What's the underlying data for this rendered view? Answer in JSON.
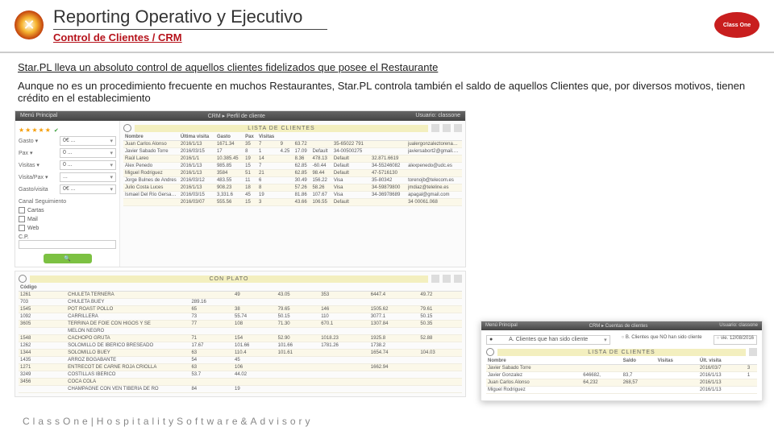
{
  "header": {
    "title": "Reporting Operativo y Ejecutivo",
    "subtitle": "Control de Clientes / CRM",
    "brand_right": "Class One"
  },
  "body": {
    "p1": "Star.PL lleva un absoluto control de aquellos clientes fidelizados que posee el Restaurante",
    "p2": "Aunque no es un procedimiento frecuente en muchos Restaurantes, Star.PL controla también el saldo de aquellos Clientes que, por diversos motivos, tienen crédito en el establecimiento"
  },
  "shot1": {
    "bar_left": "Menú Principal",
    "bar_mid": "CRM ▸ Perfil de cliente",
    "bar_right": "Usuario: classone",
    "stars": "★★★★★",
    "filters": {
      "gasto": "Gasto ▾",
      "gasto_val": "0€  ...",
      "visitas": "Visitas ▾",
      "visitas_val": "0  ...",
      "gastovis": "Gasto/visita",
      "gastovis_val": "0€  ...",
      "canal": "Canal Seguimiento",
      "opt1": "Cartas",
      "opt2": "Mail",
      "opt3": "Web",
      "cp": "C.P.",
      "search": "🔍"
    },
    "list_title": "LISTA DE CLIENTES",
    "cols": [
      "Nombre",
      "Última visita",
      "Gasto",
      "Pax",
      "Visitas",
      "",
      "",
      "",
      "",
      "",
      ""
    ],
    "rows": [
      [
        "Juan Carlos Alonso",
        "2016/1/13",
        "1671.34",
        "35",
        "7",
        "9",
        "63.72",
        "",
        "35-65022 791",
        "",
        "jualergonzaleztorena@gmail.com"
      ],
      [
        "Javier Sabado Torre",
        "2016/03/15",
        "17",
        "8",
        "1",
        "4.25",
        "17.09",
        "Default",
        "34-00500275",
        "",
        "javiersabort2@gmail.com"
      ],
      [
        "Raúl Lareo",
        "2016/1/1",
        "10.385.45",
        "19",
        "14",
        "",
        "8.36",
        "478.13",
        "Default",
        "32.871.6619",
        ""
      ],
      [
        "Álex Penedo",
        "2016/1/13",
        "985.85",
        "15",
        "7",
        "",
        "62.85",
        "-60.44",
        "Default",
        "34-55246082",
        "alexpenedo@udc.es"
      ],
      [
        "Miguel Rodriguez",
        "2016/1/13",
        "3584",
        "51",
        "21",
        "",
        "62.85",
        "98.44",
        "Default",
        "47-5716130",
        ""
      ],
      [
        "Jorge Bulnes de Andres",
        "2016/03/12",
        "483.55",
        "11",
        "6",
        "",
        "30.49",
        "156.22",
        "Visa",
        "35-80342",
        "torenojb@telecom.es"
      ],
      [
        "Julio Costa Luces",
        "2016/1/13",
        "908.23",
        "18",
        "8",
        "",
        "57.26",
        "58.26",
        "Visa",
        "34-59879800",
        "jmdiaz@teleline.es"
      ],
      [
        "Ismael Del Río Gersapio",
        "2016/03/15",
        "3,331.6",
        "45",
        "19",
        "",
        "81.86",
        "107.67",
        "Visa",
        "34-36978689",
        "apagal@gmail.com"
      ],
      [
        "",
        "2016/03/07",
        "555.56",
        "15",
        "3",
        "",
        "43.66",
        "106.55",
        "Default",
        "",
        "34 00061.068"
      ]
    ]
  },
  "shot2": {
    "list_title": "CON PLATO",
    "cols": [
      "Código",
      "",
      "",
      "",
      "",
      "",
      "",
      "",
      ""
    ],
    "rows": [
      [
        "1261",
        "CHULETA TERNERA",
        "",
        "",
        "49",
        "43.05",
        "353",
        "6447.4",
        "49.72"
      ],
      [
        "703",
        "CHULETA BUEY",
        "",
        "289.16",
        "",
        "",
        "",
        "",
        ""
      ],
      [
        "1545",
        "POT ROAST POLLO",
        "",
        "65",
        "38",
        "79.65",
        "146",
        "1505.62",
        "79.61"
      ],
      [
        "1092",
        "CARRILLERA",
        "",
        "73",
        "55.74",
        "50.15",
        "110",
        "3077.1",
        "50.15"
      ],
      [
        "3605",
        "TERRINA DE FOIE CON HIGOS Y SE",
        "",
        "77",
        "108",
        "71.30",
        "670.1",
        "1307.84",
        "50.35"
      ],
      [
        "",
        "MELON NEGRO",
        "",
        "",
        "",
        "",
        "",
        "",
        ""
      ],
      [
        "1548",
        "CACHOPO GRUTA",
        "",
        "71",
        "154",
        "52.90",
        "1018.23",
        "1925.8",
        "52.88"
      ],
      [
        "1262",
        "SOLOMILLO DE IBERICO BRESEADO",
        "",
        "17.67",
        "101.66",
        "101.66",
        "1781.26",
        "1738.2",
        ""
      ],
      [
        "1344",
        "SOLOMILLO BUEY",
        "",
        "63",
        "110.4",
        "101.61",
        "",
        "1654.74",
        "104.03"
      ],
      [
        "1435",
        "ARROZ BOGABANTE",
        "",
        "54",
        "45",
        "",
        "",
        "",
        ""
      ],
      [
        "1271",
        "ENTRECOT DE CARNE ROJA CRIOLLA",
        "",
        "63",
        "106",
        "",
        "",
        "1662.94",
        ""
      ],
      [
        "3249",
        "COSTILLAS IBERICO",
        "",
        "53.7",
        "44.02",
        "",
        "",
        "",
        ""
      ],
      [
        "3456",
        "COCA COLA",
        "",
        "",
        "",
        "",
        "",
        "",
        ""
      ],
      [
        "",
        "CHAMPAGNE CON VEN TIBERIA DE RO",
        "",
        "84",
        "19",
        "",
        "",
        "",
        ""
      ]
    ]
  },
  "shot3": {
    "bar_left": "Menú Principal",
    "bar_mid": "CRM ▸ Cuentas de clientes",
    "bar_right": "Usuario: classone",
    "radio1": "A. Clientes que han sido cliente",
    "radio2": "B. Clientes que NO han sido cliente",
    "date": "vie. 12/08/2016",
    "list_title": "LISTA DE CLIENTES",
    "cols": [
      "Nombre",
      "",
      "",
      "Saldo",
      "Visitas",
      "",
      "Últ. visita",
      ""
    ],
    "rows": [
      [
        "Javier Sabado Torre",
        "",
        "",
        "",
        "",
        "",
        "2016/03/7",
        "3"
      ],
      [
        "Javier Gonzalez",
        "",
        "646682,",
        "83,7",
        "",
        "",
        "2016/1/13",
        "1"
      ],
      [
        "Juan Carlos Alonso",
        "",
        "64,232",
        "268,57",
        "",
        "",
        "2016/1/13",
        ""
      ],
      [
        "Miguel Rodriguez",
        "",
        "",
        "",
        "",
        "",
        "2016/1/13",
        ""
      ]
    ]
  },
  "footer": "ClassOne|HospitalitySoftware&Advisory"
}
